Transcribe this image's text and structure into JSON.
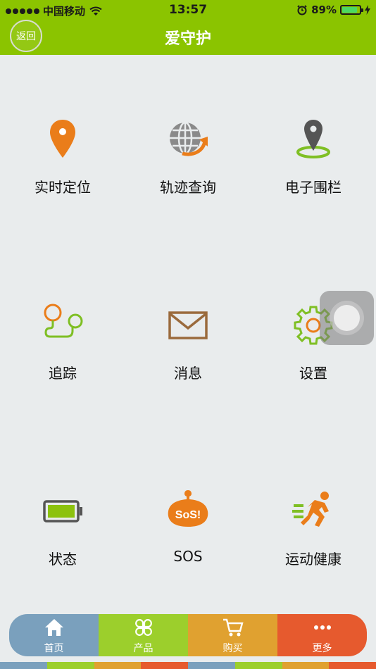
{
  "status_bar": {
    "carrier": "中国移动",
    "time": "13:57",
    "battery": "89%",
    "battery_level": 0.89
  },
  "header": {
    "back_label": "返回",
    "title": "爱守护"
  },
  "tiles": [
    {
      "label": "实时定位",
      "icon": "location-pin-icon"
    },
    {
      "label": "轨迹查询",
      "icon": "globe-arrow-icon"
    },
    {
      "label": "电子围栏",
      "icon": "geofence-icon"
    },
    {
      "label": "追踪",
      "icon": "tracking-icon"
    },
    {
      "label": "消息",
      "icon": "mail-icon"
    },
    {
      "label": "设置",
      "icon": "gear-icon"
    },
    {
      "label": "状态",
      "icon": "battery-icon"
    },
    {
      "label": "SOS",
      "icon": "sos-icon"
    },
    {
      "label": "运动健康",
      "icon": "running-icon"
    }
  ],
  "bottom_nav": [
    {
      "label": "首页",
      "icon": "home-icon",
      "color": "#7aa0bd"
    },
    {
      "label": "产品",
      "icon": "clover-icon",
      "color": "#9ccf2c"
    },
    {
      "label": "购买",
      "icon": "cart-icon",
      "color": "#e0a130"
    },
    {
      "label": "更多",
      "icon": "more-icon",
      "color": "#e65a2e"
    }
  ],
  "colors": {
    "header": "#8bc400",
    "background": "#e9eced",
    "orange": "#ea7d1a",
    "green": "#7fbf24"
  }
}
